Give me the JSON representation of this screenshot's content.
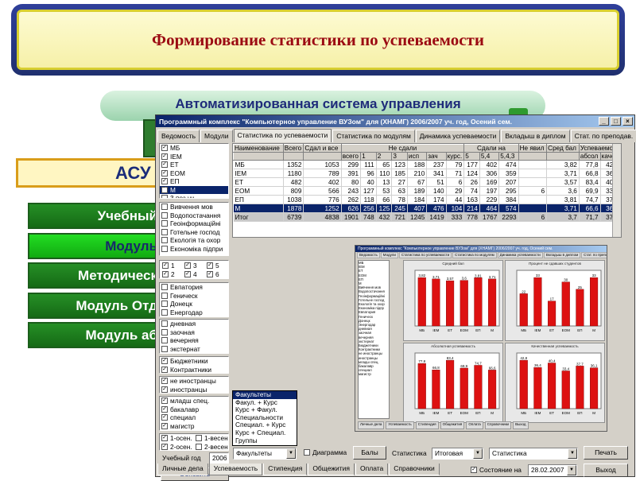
{
  "slide": {
    "title": "Формирование статистики по успеваемости",
    "subtitle": "Автоматизированная система управления",
    "acu_label": "АСУ",
    "modules": [
      "Учебный",
      "Модуль",
      "Методическ",
      "Модуль Отд",
      "Модуль аб"
    ]
  },
  "window": {
    "title": "Программный комплекс \"Компьютерное управление ВУЗом\" для          (ХНАМГ)     2006/2007 уч. год, Осений сем.",
    "buttons": [
      "_",
      "□",
      "×"
    ],
    "tabs": [
      "Ведомость",
      "Модули",
      "Статистика по успеваемости",
      "Статистика по модулям",
      "Динамика успеваемости",
      "Вкладыш в диплом",
      "Стат. по преподав."
    ],
    "active_tab": 2,
    "left_panel": {
      "groups": [
        "МБ",
        "IEM",
        "ЕТ",
        "ЕОМ",
        "ЕП",
        "М",
        "3 поз уч."
      ],
      "groups_checked": [
        true,
        true,
        true,
        true,
        true,
        true,
        false
      ],
      "groups_selected": 5,
      "specialties": [
        "Вивчення мов",
        "Водопостачання",
        "Геоінформаційні",
        "Готельне господ",
        "Екологія та охор",
        "Економіка підпри"
      ],
      "courses": [
        "1",
        "3",
        "5",
        "2",
        "4",
        "6"
      ],
      "cities": [
        "Евпатория",
        "Геническ",
        "Донецк",
        "Енергодар"
      ],
      "study_forms": [
        "дневная",
        "заочная",
        "вечерняя",
        "экстернат"
      ],
      "finance": [
        "Бюджетники",
        "Контрактники"
      ],
      "citizenship": [
        "не иностранцы",
        "иностранцы"
      ],
      "degrees": [
        "младш спец.",
        "бакалавр",
        "специал",
        "магистр"
      ],
      "semesters": [
        "1-осен.",
        "1-весен",
        "2-осен.",
        "2-весен"
      ],
      "year_label": "Учебный год",
      "year_value": "2006",
      "refresh_button": "Обновить"
    },
    "table": {
      "headers_top": [
        "Наименование",
        "Всего",
        "Сдал и все",
        "Не сдали",
        "",
        "",
        "",
        "",
        "",
        "",
        "Сдали на",
        "",
        "",
        "Не явил",
        "Сред бал",
        "Успеваемос",
        ""
      ],
      "headers_sub": [
        "",
        "",
        "",
        "всего",
        "1",
        "2",
        "3",
        "исп",
        "зач",
        "курс.",
        "5",
        "5,4",
        "5,4,3",
        "",
        "",
        "абсол",
        "качес"
      ],
      "rows": [
        [
          "МБ",
          "1352",
          "1053",
          "299",
          "111",
          "65",
          "123",
          "188",
          "237",
          "79",
          "177",
          "402",
          "474",
          "",
          "3,82",
          "77,8",
          "42,8"
        ],
        [
          "IEM",
          "1180",
          "789",
          "391",
          "96",
          "110",
          "185",
          "210",
          "341",
          "71",
          "124",
          "306",
          "359",
          "",
          "3,71",
          "66,8",
          "36,4"
        ],
        [
          "ЕТ",
          "482",
          "402",
          "80",
          "40",
          "13",
          "27",
          "67",
          "51",
          "6",
          "26",
          "169",
          "207",
          "",
          "3,57",
          "83,4",
          "40,4"
        ],
        [
          "ЕОМ",
          "809",
          "566",
          "243",
          "127",
          "53",
          "63",
          "189",
          "140",
          "29",
          "74",
          "197",
          "295",
          "6",
          "3,6",
          "69,9",
          "33,4"
        ],
        [
          "ЕП",
          "1038",
          "776",
          "262",
          "118",
          "66",
          "78",
          "184",
          "174",
          "44",
          "163",
          "229",
          "384",
          "",
          "3,81",
          "74,7",
          "37,7"
        ],
        [
          "М",
          "1878",
          "1252",
          "626",
          "256",
          "125",
          "245",
          "407",
          "476",
          "104",
          "214",
          "464",
          "574",
          "",
          "3,71",
          "66,6",
          "36,1"
        ],
        [
          "Итог",
          "6739",
          "4838",
          "1901",
          "748",
          "432",
          "721",
          "1245",
          "1419",
          "333",
          "778",
          "1767",
          "2293",
          "6",
          "3,7",
          "71,7",
          "37,7"
        ]
      ]
    },
    "inner_screenshot": {
      "title": "Программный комплекс \"Компьютерное управление ВУЗом\" для        (ХНАМГ)   2006/2007 уч. год, Осений сем.",
      "tabs": [
        "Ведомость",
        "Модули",
        "Статистика по успеваемости",
        "Статистика по модулям",
        "Динамика успеваемости",
        "Вкладыш в диплом",
        "Стат. по преподав."
      ],
      "list": [
        "МБ",
        "IEM",
        "ЕТ",
        "ЕОМ",
        "ЕП",
        "М",
        "Вивчення мов",
        "Водопостачання",
        "Геоінформаційні",
        "Готельне господ",
        "Екологія та охор",
        "Економіка підпр",
        "Евпатория",
        "Геническ",
        "Донецк",
        "Энергодар",
        "дневная",
        "заочная",
        "вечерняя",
        "экстернат",
        "Бюджетники",
        "Контрактники",
        "не иностранцы",
        "иностранцы",
        "младш спец.",
        "бакалавр",
        "специал",
        "магистр"
      ],
      "bottom": [
        "Личные дела",
        "Успеваемость",
        "Стипендия",
        "Общежития",
        "Оплата",
        "Справочники",
        "Выход"
      ],
      "colors": {
        "bar": "#dd1111",
        "axis_bg": "#ffffff"
      },
      "charts": [
        {
          "title": "Средний бал",
          "categories": [
            "МБ",
            "IEM",
            "ЕТ",
            "ЕОМ",
            "ЕП",
            "М"
          ],
          "values": [
            3.82,
            3.71,
            3.57,
            3.6,
            3.81,
            3.71
          ],
          "labels": [
            "3,82",
            "3,71",
            "3,57",
            "3,6",
            "3,81",
            "3,71"
          ]
        },
        {
          "title": "Процент не сдавших студентов",
          "categories": [
            "МБ",
            "IEM",
            "ЕТ",
            "ЕОМ",
            "ЕП",
            "М"
          ],
          "values": [
            22,
            33,
            17,
            30,
            25,
            33
          ],
          "labels": [
            "22",
            "33",
            "17",
            "30",
            "25",
            "33"
          ]
        },
        {
          "title": "Абсолютная успеваемость",
          "categories": [
            "МБ",
            "IEM",
            "ЕТ",
            "ЕОМ",
            "ЕП",
            "М"
          ],
          "values": [
            77.8,
            66.8,
            83.4,
            69.9,
            74.7,
            66.6
          ],
          "labels": [
            "77,8",
            "66,8",
            "83,4",
            "69,9",
            "74,7",
            "66,6"
          ]
        },
        {
          "title": "Качественная успеваемость",
          "categories": [
            "МБ",
            "IEM",
            "ЕТ",
            "ЕОМ",
            "ЕП",
            "М"
          ],
          "values": [
            42.8,
            36.4,
            40.4,
            33.4,
            37.7,
            36.1
          ],
          "labels": [
            "42,8",
            "36,4",
            "40,4",
            "33,4",
            "37,7",
            "36,1"
          ]
        }
      ]
    },
    "dropdown_menu": [
      "Факультеты",
      "Факул. + Курс",
      "Курс + Факул.",
      "Специальности",
      "Специал. + Курс",
      "Курс + Специал.",
      "Группы"
    ],
    "dropdown_selected": 0,
    "controls": {
      "grouping_value": "Факультеты",
      "diagram_label": "Диаграмма",
      "bally_button": "Балы",
      "statistics_label": "Статистика",
      "statistics_value": "Итоговая",
      "statistics_value2": "Статистика",
      "print_button": "Печать",
      "state_label": "Состояние на",
      "state_date": "28.02.2007",
      "exit_button": "Выход"
    },
    "bottom_tabs": [
      "Личные дела",
      "Успеваемость",
      "Стипендия",
      "Общежития",
      "Оплата",
      "Справочники"
    ],
    "bottom_active": 1
  }
}
